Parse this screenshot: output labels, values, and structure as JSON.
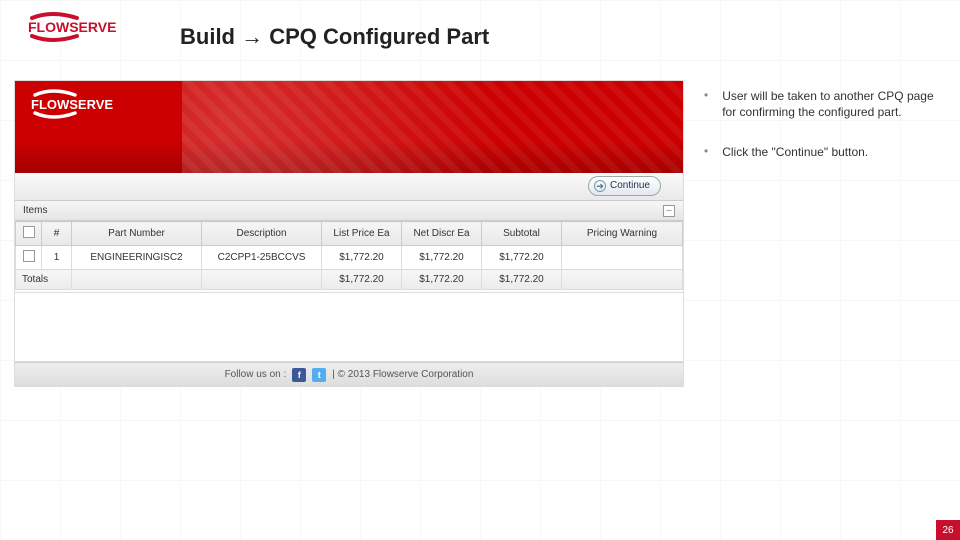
{
  "title": "Build → CPQ Configured Part",
  "logo_text": "FLOWSERVE",
  "instructions": [
    "User will be taken to another CPQ page for confirming the configured part.",
    "Click the \"Continue\" button."
  ],
  "screenshot": {
    "continue_label": "Continue",
    "items_label": "Items",
    "columns": {
      "num": "#",
      "part_number": "Part Number",
      "description": "Description",
      "list_price": "List Price Ea",
      "net_discr": "Net Discr Ea",
      "subtotal": "Subtotal",
      "pricing_warning": "Pricing Warning"
    },
    "row": {
      "num": "1",
      "part_number": "ENGINEERINGISC2",
      "description": "C2CPP1-25BCCVS",
      "list_price": "$1,772.20",
      "net_discr": "$1,772.20",
      "subtotal": "$1,772.20",
      "pricing_warning": ""
    },
    "totals": {
      "label": "Totals",
      "list_price": "$1,772.20",
      "net_discr": "$1,772.20",
      "subtotal": "$1,772.20"
    },
    "footer": {
      "follow": "Follow us on :",
      "copyright": "| © 2013 Flowserve Corporation"
    }
  },
  "page_number": "26"
}
